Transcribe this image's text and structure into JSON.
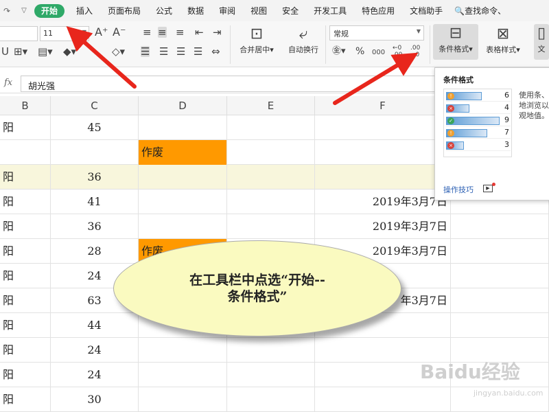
{
  "menubar": {
    "undo_icon": "undo-icon",
    "more_icon": "chevron-down-icon",
    "tabs": [
      "开始",
      "插入",
      "页面布局",
      "公式",
      "数据",
      "审阅",
      "视图",
      "安全",
      "开发工具",
      "特色应用",
      "文档助手"
    ],
    "search": "查找命令、"
  },
  "ribbon": {
    "font_size": "11",
    "number_format": "常规",
    "merge_label": "合并居中",
    "wrap_label": "自动换行",
    "cond_format_label": "条件格式",
    "table_style_label": "表格样式",
    "doc_label": "文",
    "percent": "%",
    "comma": "000"
  },
  "formula_bar": {
    "fx": "fx",
    "value": "胡光强"
  },
  "columns": [
    "B",
    "C",
    "D",
    "E",
    "F"
  ],
  "rows": [
    {
      "b": "阳",
      "c": "45",
      "d": "",
      "f": "",
      "highlight": false,
      "void": false
    },
    {
      "b": "",
      "c": "",
      "d": "作废",
      "f": "",
      "highlight": false,
      "void": true
    },
    {
      "b": "阳",
      "c": "36",
      "d": "",
      "f": "",
      "highlight": true,
      "void": false
    },
    {
      "b": "阳",
      "c": "41",
      "d": "",
      "f": "2019年3月7日",
      "highlight": false,
      "void": false
    },
    {
      "b": "阳",
      "c": "36",
      "d": "",
      "f": "2019年3月7日",
      "highlight": false,
      "void": false
    },
    {
      "b": "阳",
      "c": "28",
      "d": "作废",
      "f": "2019年3月7日",
      "highlight": false,
      "void": true
    },
    {
      "b": "阳",
      "c": "24",
      "d": "",
      "f": "",
      "highlight": false,
      "void": false
    },
    {
      "b": "阳",
      "c": "63",
      "d": "",
      "f": "年3月7日",
      "highlight": false,
      "void": false
    },
    {
      "b": "阳",
      "c": "44",
      "d": "",
      "f": "",
      "highlight": false,
      "void": false
    },
    {
      "b": "阳",
      "c": "24",
      "d": "",
      "f": "",
      "highlight": false,
      "void": false
    },
    {
      "b": "阳",
      "c": "24",
      "d": "",
      "f": "",
      "highlight": false,
      "void": false
    },
    {
      "b": "阳",
      "c": "30",
      "d": "",
      "f": "",
      "highlight": false,
      "void": false
    }
  ],
  "popup": {
    "title": "条件格式",
    "description": "使用条、松地浏览以直观地值。",
    "preview_values": [
      "6",
      "4",
      "9",
      "7",
      "3"
    ],
    "tips": "操作技巧"
  },
  "callout": {
    "line1": "在工具栏中点选“开始--",
    "line2": "条件格式”"
  },
  "watermark": {
    "brand": "Baidu经验",
    "url": "jingyan.baidu.com"
  }
}
